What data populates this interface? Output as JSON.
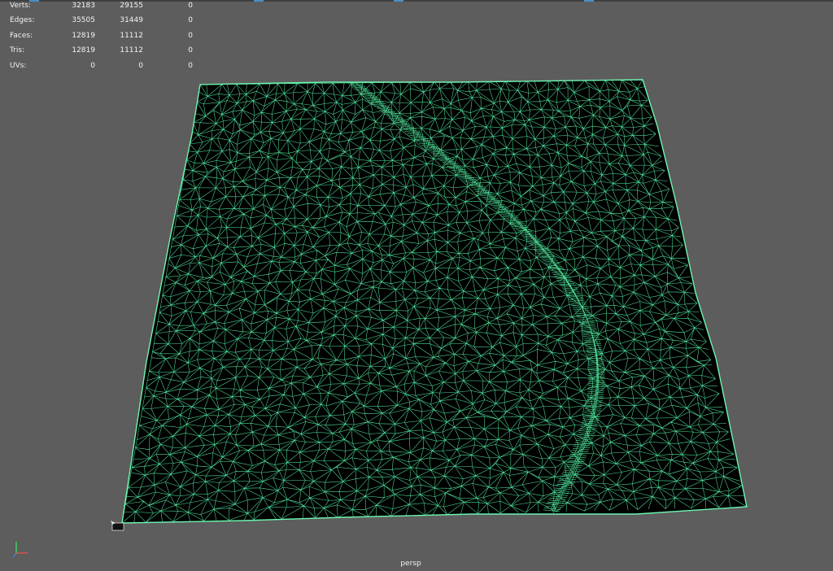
{
  "hud": {
    "rows": [
      {
        "label": "Verts:",
        "v1": "32183",
        "v2": "29155",
        "v3": "0"
      },
      {
        "label": "Edges:",
        "v1": "35505",
        "v2": "31449",
        "v3": "0"
      },
      {
        "label": "Faces:",
        "v1": "12819",
        "v2": "11112",
        "v3": "0"
      },
      {
        "label": "Tris:",
        "v1": "12819",
        "v2": "11112",
        "v3": "0"
      },
      {
        "label": "UVs:",
        "v1": "0",
        "v2": "0",
        "v3": "0"
      }
    ]
  },
  "viewport": {
    "camera_label": "persp",
    "background_color": "#5d5d5d",
    "wireframe_color": "#4fe39a",
    "mesh_fill_color": "#000000",
    "axis_icons": [
      "y-axis-icon",
      "x-axis-icon",
      "z-axis-icon"
    ]
  }
}
